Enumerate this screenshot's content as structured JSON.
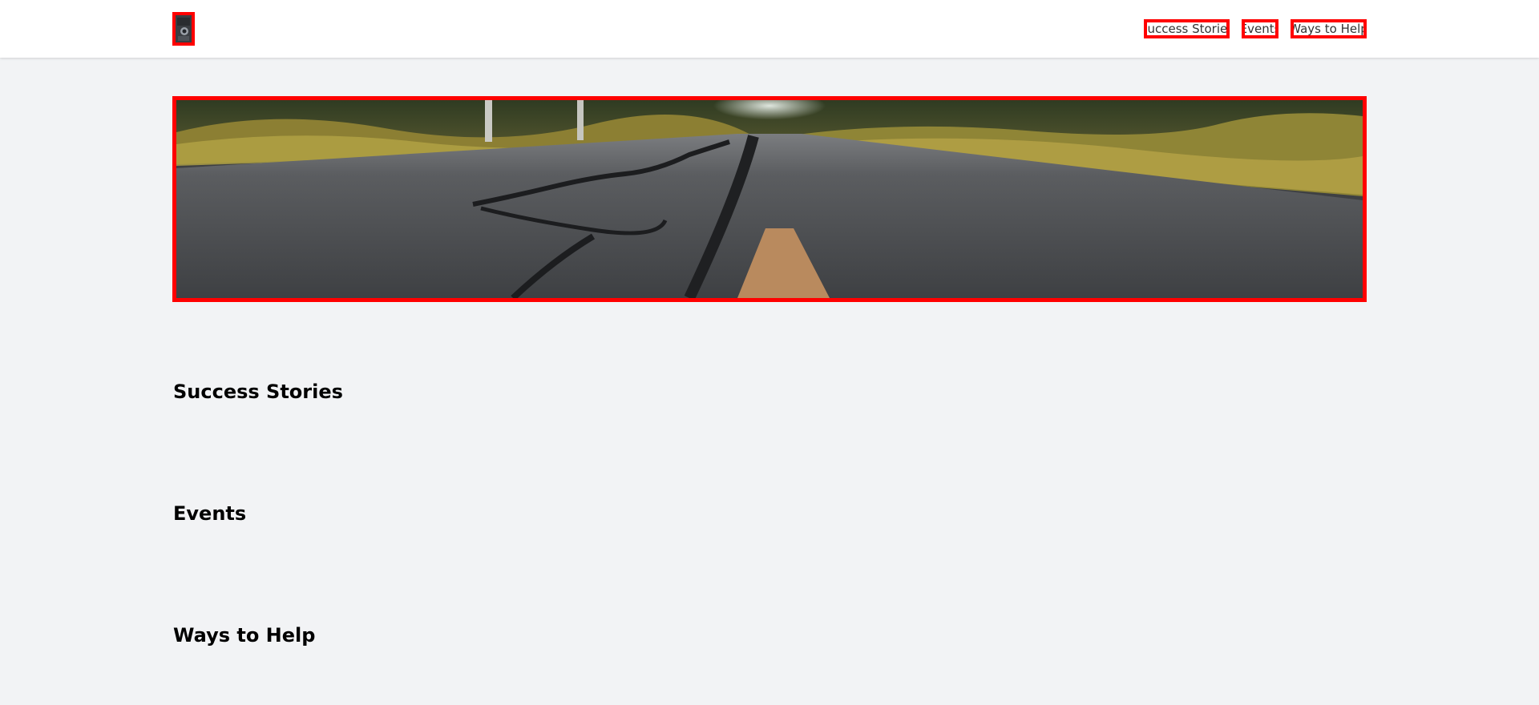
{
  "header": {
    "logo_icon": "avatar-portrait-icon",
    "nav": [
      {
        "label": "Success Stories"
      },
      {
        "label": "Events"
      },
      {
        "label": "Ways to Help"
      }
    ]
  },
  "hero": {
    "image": "road-photo",
    "colors": {
      "asphalt": "#4a4c4f",
      "foliage": "#a89a3a",
      "centerline": "#b98a5e"
    }
  },
  "sections": [
    {
      "title": "Success Stories"
    },
    {
      "title": "Events"
    },
    {
      "title": "Ways to Help"
    }
  ],
  "colors": {
    "page_background": "#f2f3f5",
    "header_background": "#ffffff",
    "highlight_border": "#ff0000"
  }
}
